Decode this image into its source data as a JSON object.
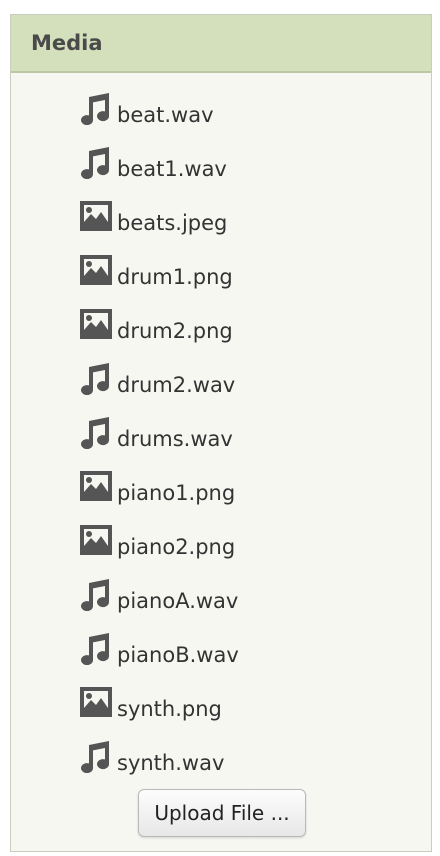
{
  "panel": {
    "title": "Media"
  },
  "media": [
    {
      "name": "beat.wav",
      "type": "audio",
      "icon": "music-note-icon"
    },
    {
      "name": "beat1.wav",
      "type": "audio",
      "icon": "music-note-icon"
    },
    {
      "name": "beats.jpeg",
      "type": "image",
      "icon": "image-icon"
    },
    {
      "name": "drum1.png",
      "type": "image",
      "icon": "image-icon"
    },
    {
      "name": "drum2.png",
      "type": "image",
      "icon": "image-icon"
    },
    {
      "name": "drum2.wav",
      "type": "audio",
      "icon": "music-note-icon"
    },
    {
      "name": "drums.wav",
      "type": "audio",
      "icon": "music-note-icon"
    },
    {
      "name": "piano1.png",
      "type": "image",
      "icon": "image-icon"
    },
    {
      "name": "piano2.png",
      "type": "image",
      "icon": "image-icon"
    },
    {
      "name": "pianoA.wav",
      "type": "audio",
      "icon": "music-note-icon"
    },
    {
      "name": "pianoB.wav",
      "type": "audio",
      "icon": "music-note-icon"
    },
    {
      "name": "synth.png",
      "type": "image",
      "icon": "image-icon"
    },
    {
      "name": "synth.wav",
      "type": "audio",
      "icon": "music-note-icon"
    }
  ],
  "upload_button": {
    "label": "Upload File ..."
  },
  "colors": {
    "header_bg": "#d3e0bb",
    "panel_bg": "#f7f7f2",
    "icon": "#555555",
    "text": "#333333"
  }
}
